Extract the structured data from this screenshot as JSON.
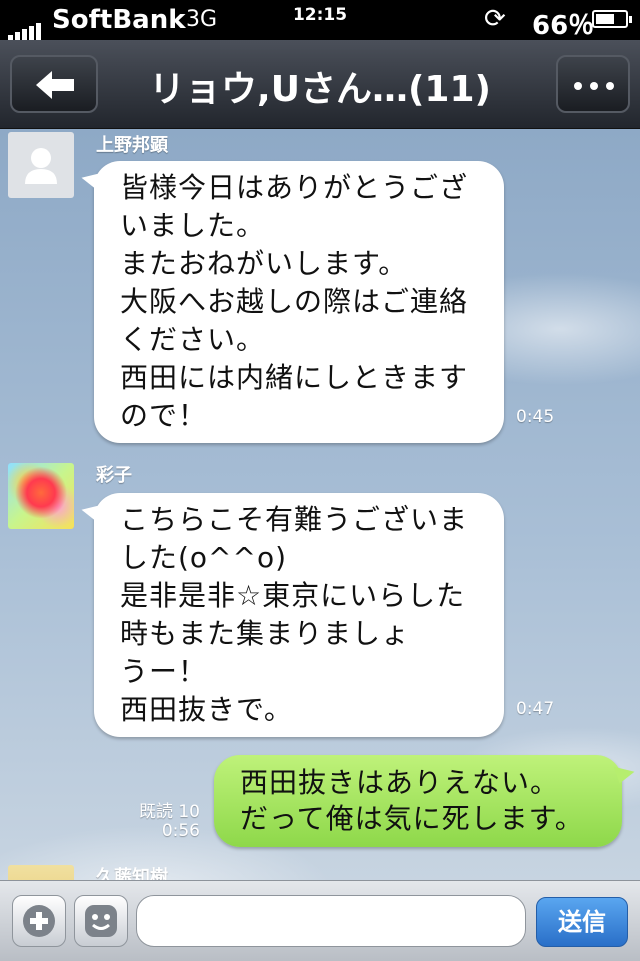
{
  "status_bar": {
    "carrier": "SoftBank",
    "network": "3G",
    "time": "12:15",
    "battery": "66％",
    "battery_level": 0.66
  },
  "nav": {
    "title": "リョウ,Uさん…(11)",
    "back_icon": "back-arrow-icon",
    "more_icon": "more-icon"
  },
  "messages": [
    {
      "sender": "上野邦顕",
      "lines": [
        "皆様今日はありがとうござ",
        "いました。",
        "またおねがいします。",
        "大阪へお越しの際はご連絡",
        "ください。",
        "西田には内緒にしときます",
        "ので！"
      ],
      "time": "0:45"
    },
    {
      "sender": "彩子",
      "lines": [
        "こちらこそ有難うございま",
        "した(o^^o)",
        "是非是非☆東京にいらした",
        "時もまた集まりましょ",
        "うー！",
        "西田抜きで。"
      ],
      "time": "0:47"
    },
    {
      "lines": [
        "西田抜きはありえない。",
        "だって俺は気に死します。"
      ],
      "read": "既読 10",
      "time": "0:56"
    },
    {
      "sender": "久藤知樹"
    }
  ],
  "input_bar": {
    "add_icon": "plus-icon",
    "sticker_icon": "smiley-icon",
    "message_value": "",
    "send_label": "送信"
  },
  "colors": {
    "outgoing_bubble": "#a5e35e",
    "incoming_bubble": "#ffffff",
    "send_button": "#3a86dc"
  }
}
